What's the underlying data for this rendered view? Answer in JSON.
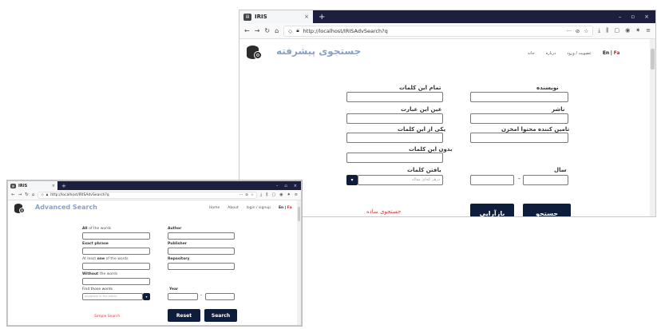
{
  "fa_window": {
    "tab_title": "IRIS",
    "tab_icon": "iris-icon",
    "new_tab": "+",
    "window_controls": [
      "–",
      "▫",
      "×"
    ],
    "url": "http://localhost/IRISAdvSearch?q",
    "page_title": "جستجوی پیشرفته",
    "menu": {
      "items": [
        "حانه",
        "درباره",
        "عضویت / ورود"
      ],
      "lang_en": "En",
      "lang_sep": "|",
      "lang_fa": "Fa"
    },
    "form": {
      "all_words": "تمام این کلمات",
      "exact_phrase": "عین این عبارت",
      "at_least_one": "یکی از این کلمات",
      "without_words": "بدون این کلمات",
      "find_words": "یافتن کلمات",
      "find_words_placeholder": "درهر کجای مقاله",
      "author": "نویسنده",
      "publisher": "ناشر",
      "repository": "تامین کننده محتوا امخزن",
      "year": "سال",
      "year_separator": "-"
    },
    "buttons": {
      "search": "جستجو",
      "reset": "بازآرایی",
      "simple_search": "جستجوی ساده"
    }
  },
  "en_window": {
    "tab_title": "IRIS",
    "tab_icon": "iris-icon",
    "new_tab": "+",
    "window_controls": [
      "–",
      "▫",
      "×"
    ],
    "url": "http://localhost/IRISAdvSearch?q",
    "page_title": "Advanced Search",
    "menu": {
      "items": [
        "Home",
        "About",
        "login / signup"
      ],
      "lang_en": "En",
      "lang_sep": "|",
      "lang_fa": "Fa"
    },
    "form": {
      "all_words_bold": "All",
      "all_words_rest": "of the words",
      "exact_phrase": "Exact phrase",
      "at_least_prefix": "At least",
      "at_least_bold": "one",
      "at_least_rest": "of the words",
      "without_bold": "Without",
      "without_rest": "the words",
      "find_words": "Find those words",
      "find_words_placeholder": "anywhere in the article",
      "author": "Author",
      "publisher": "Publisher",
      "repository": "Repository",
      "year": "Year",
      "year_separator": "-"
    },
    "buttons": {
      "search": "Search",
      "reset": "Reset",
      "simple_search": "Simple Search"
    }
  },
  "colors": {
    "tabbar": "#1d1f3f",
    "button": "#0f1d3d",
    "title_blue": "#8aa0c8",
    "link_red": "#d33b3b"
  }
}
